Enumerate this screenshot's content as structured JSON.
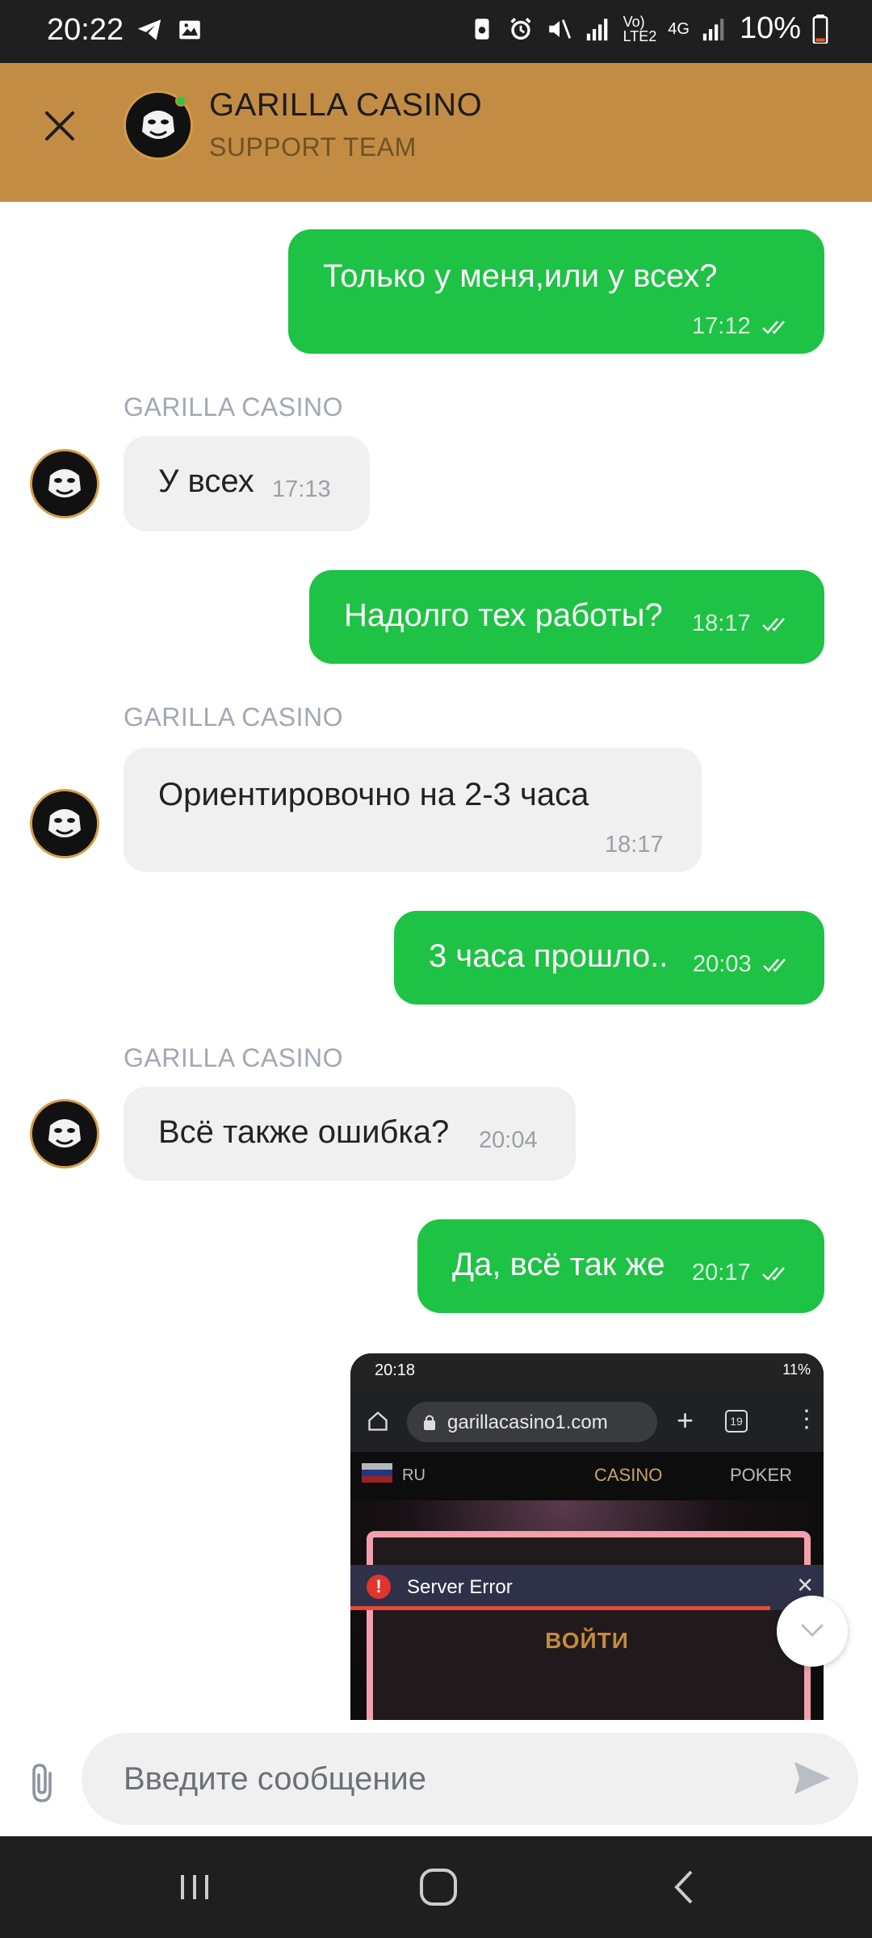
{
  "status_bar": {
    "time": "20:22",
    "battery": "10%",
    "network": "4G"
  },
  "header": {
    "title": "GARILLA CASINO",
    "subtitle": "SUPPORT TEAM"
  },
  "messages": [
    {
      "text": "Только у меня,или у всех?",
      "time": "17:12"
    },
    {
      "sender": "GARILLA CASINO",
      "text": "У всех",
      "time": "17:13"
    },
    {
      "text": "Надолго тех работы?",
      "time": "18:17"
    },
    {
      "sender": "GARILLA CASINO",
      "text": "Ориентировочно на 2-3 часа",
      "time": "18:17"
    },
    {
      "text": "3 часа прошло..",
      "time": "20:03"
    },
    {
      "sender": "GARILLA CASINO",
      "text": "Всё также ошибка?",
      "time": "20:04"
    },
    {
      "text": "Да, всё так же",
      "time": "20:17"
    }
  ],
  "attachment": {
    "time": "20:18",
    "battery": "11%",
    "url": "garillacasino1.com",
    "tab_count": "19",
    "lang": "RU",
    "nav_casino": "CASINO",
    "nav_poker": "POKER",
    "error_text": "Server Error",
    "login_text": "ВОЙТИ"
  },
  "composer": {
    "placeholder": "Введите сообщение"
  },
  "colors": {
    "accent": "#c38c44",
    "outgoing": "#1ec244",
    "incoming": "#f0f0f0"
  }
}
